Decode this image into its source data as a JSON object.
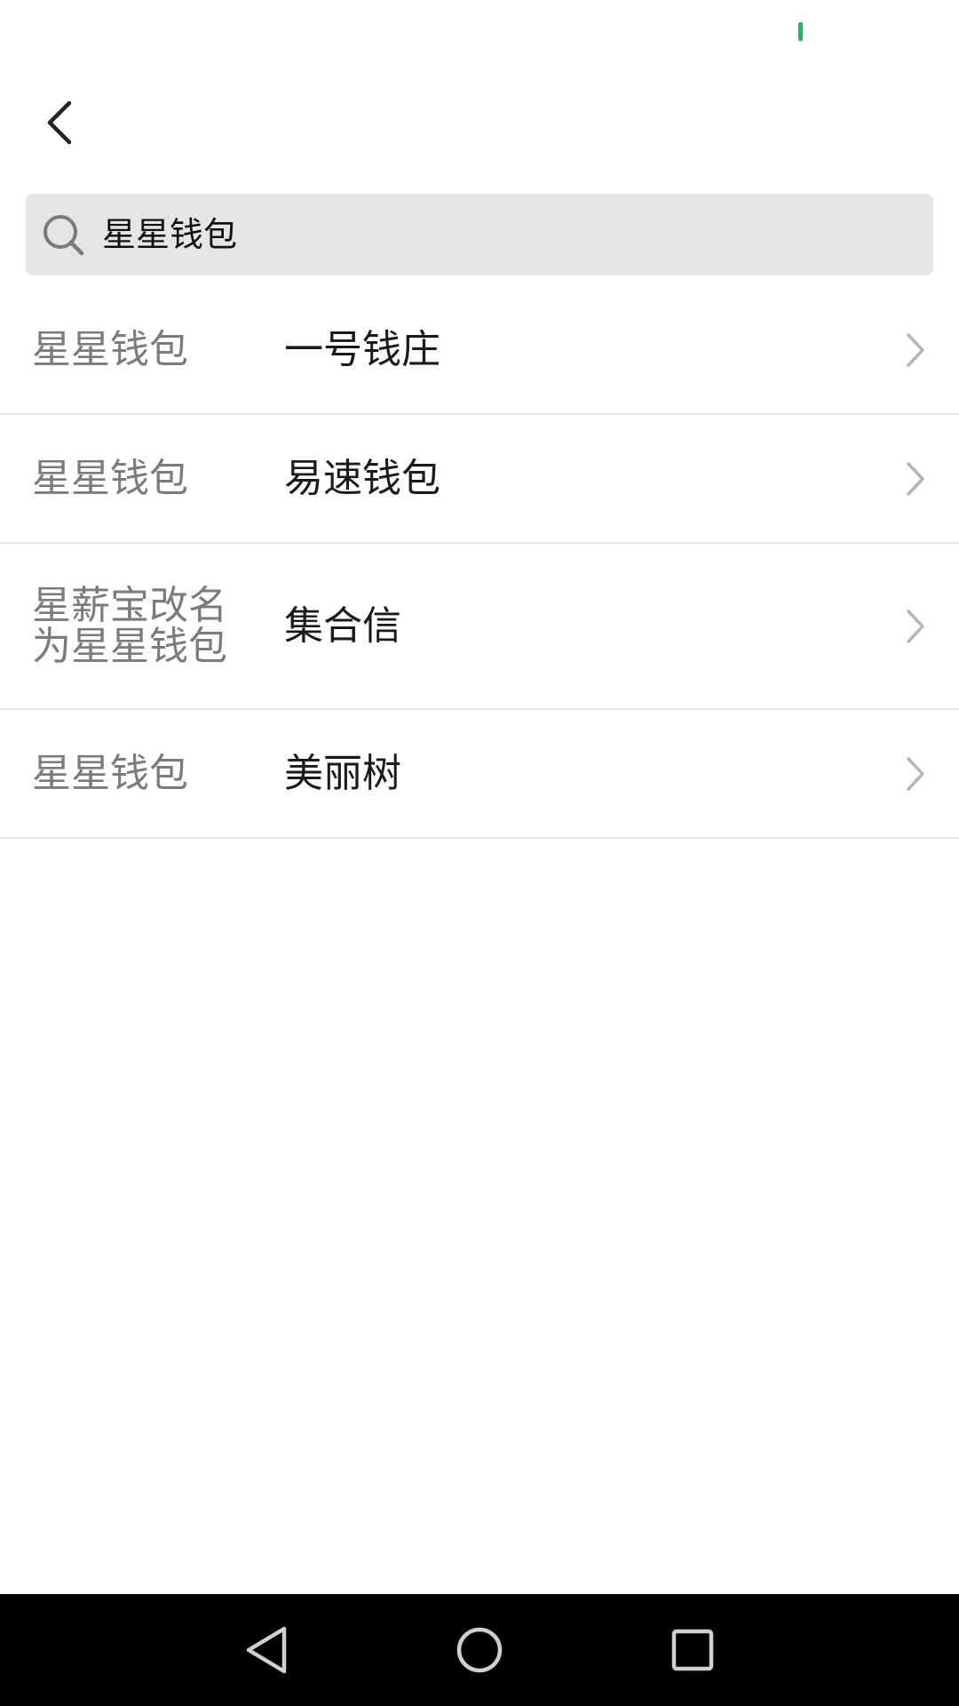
{
  "status_bar": {
    "indicator_color": "#1db954"
  },
  "header": {
    "back_icon": "chevron-left-icon"
  },
  "search": {
    "icon": "search-icon",
    "query": "星星钱包"
  },
  "results": [
    {
      "old_name": "星星钱包",
      "new_name": "一号钱庄"
    },
    {
      "old_name": "星星钱包",
      "new_name": "易速钱包"
    },
    {
      "old_name": "星薪宝改名为星星钱包",
      "new_name": "集合信"
    },
    {
      "old_name": "星星钱包",
      "new_name": "美丽树"
    }
  ],
  "nav_bar": {
    "back_icon": "triangle-back-icon",
    "home_icon": "circle-home-icon",
    "recents_icon": "square-recents-icon"
  },
  "colors": {
    "old_name_text": "#7b7b7b",
    "new_name_text": "#1a1a1a",
    "search_bg": "#e5e5e5",
    "divider": "#e6e6e6"
  }
}
